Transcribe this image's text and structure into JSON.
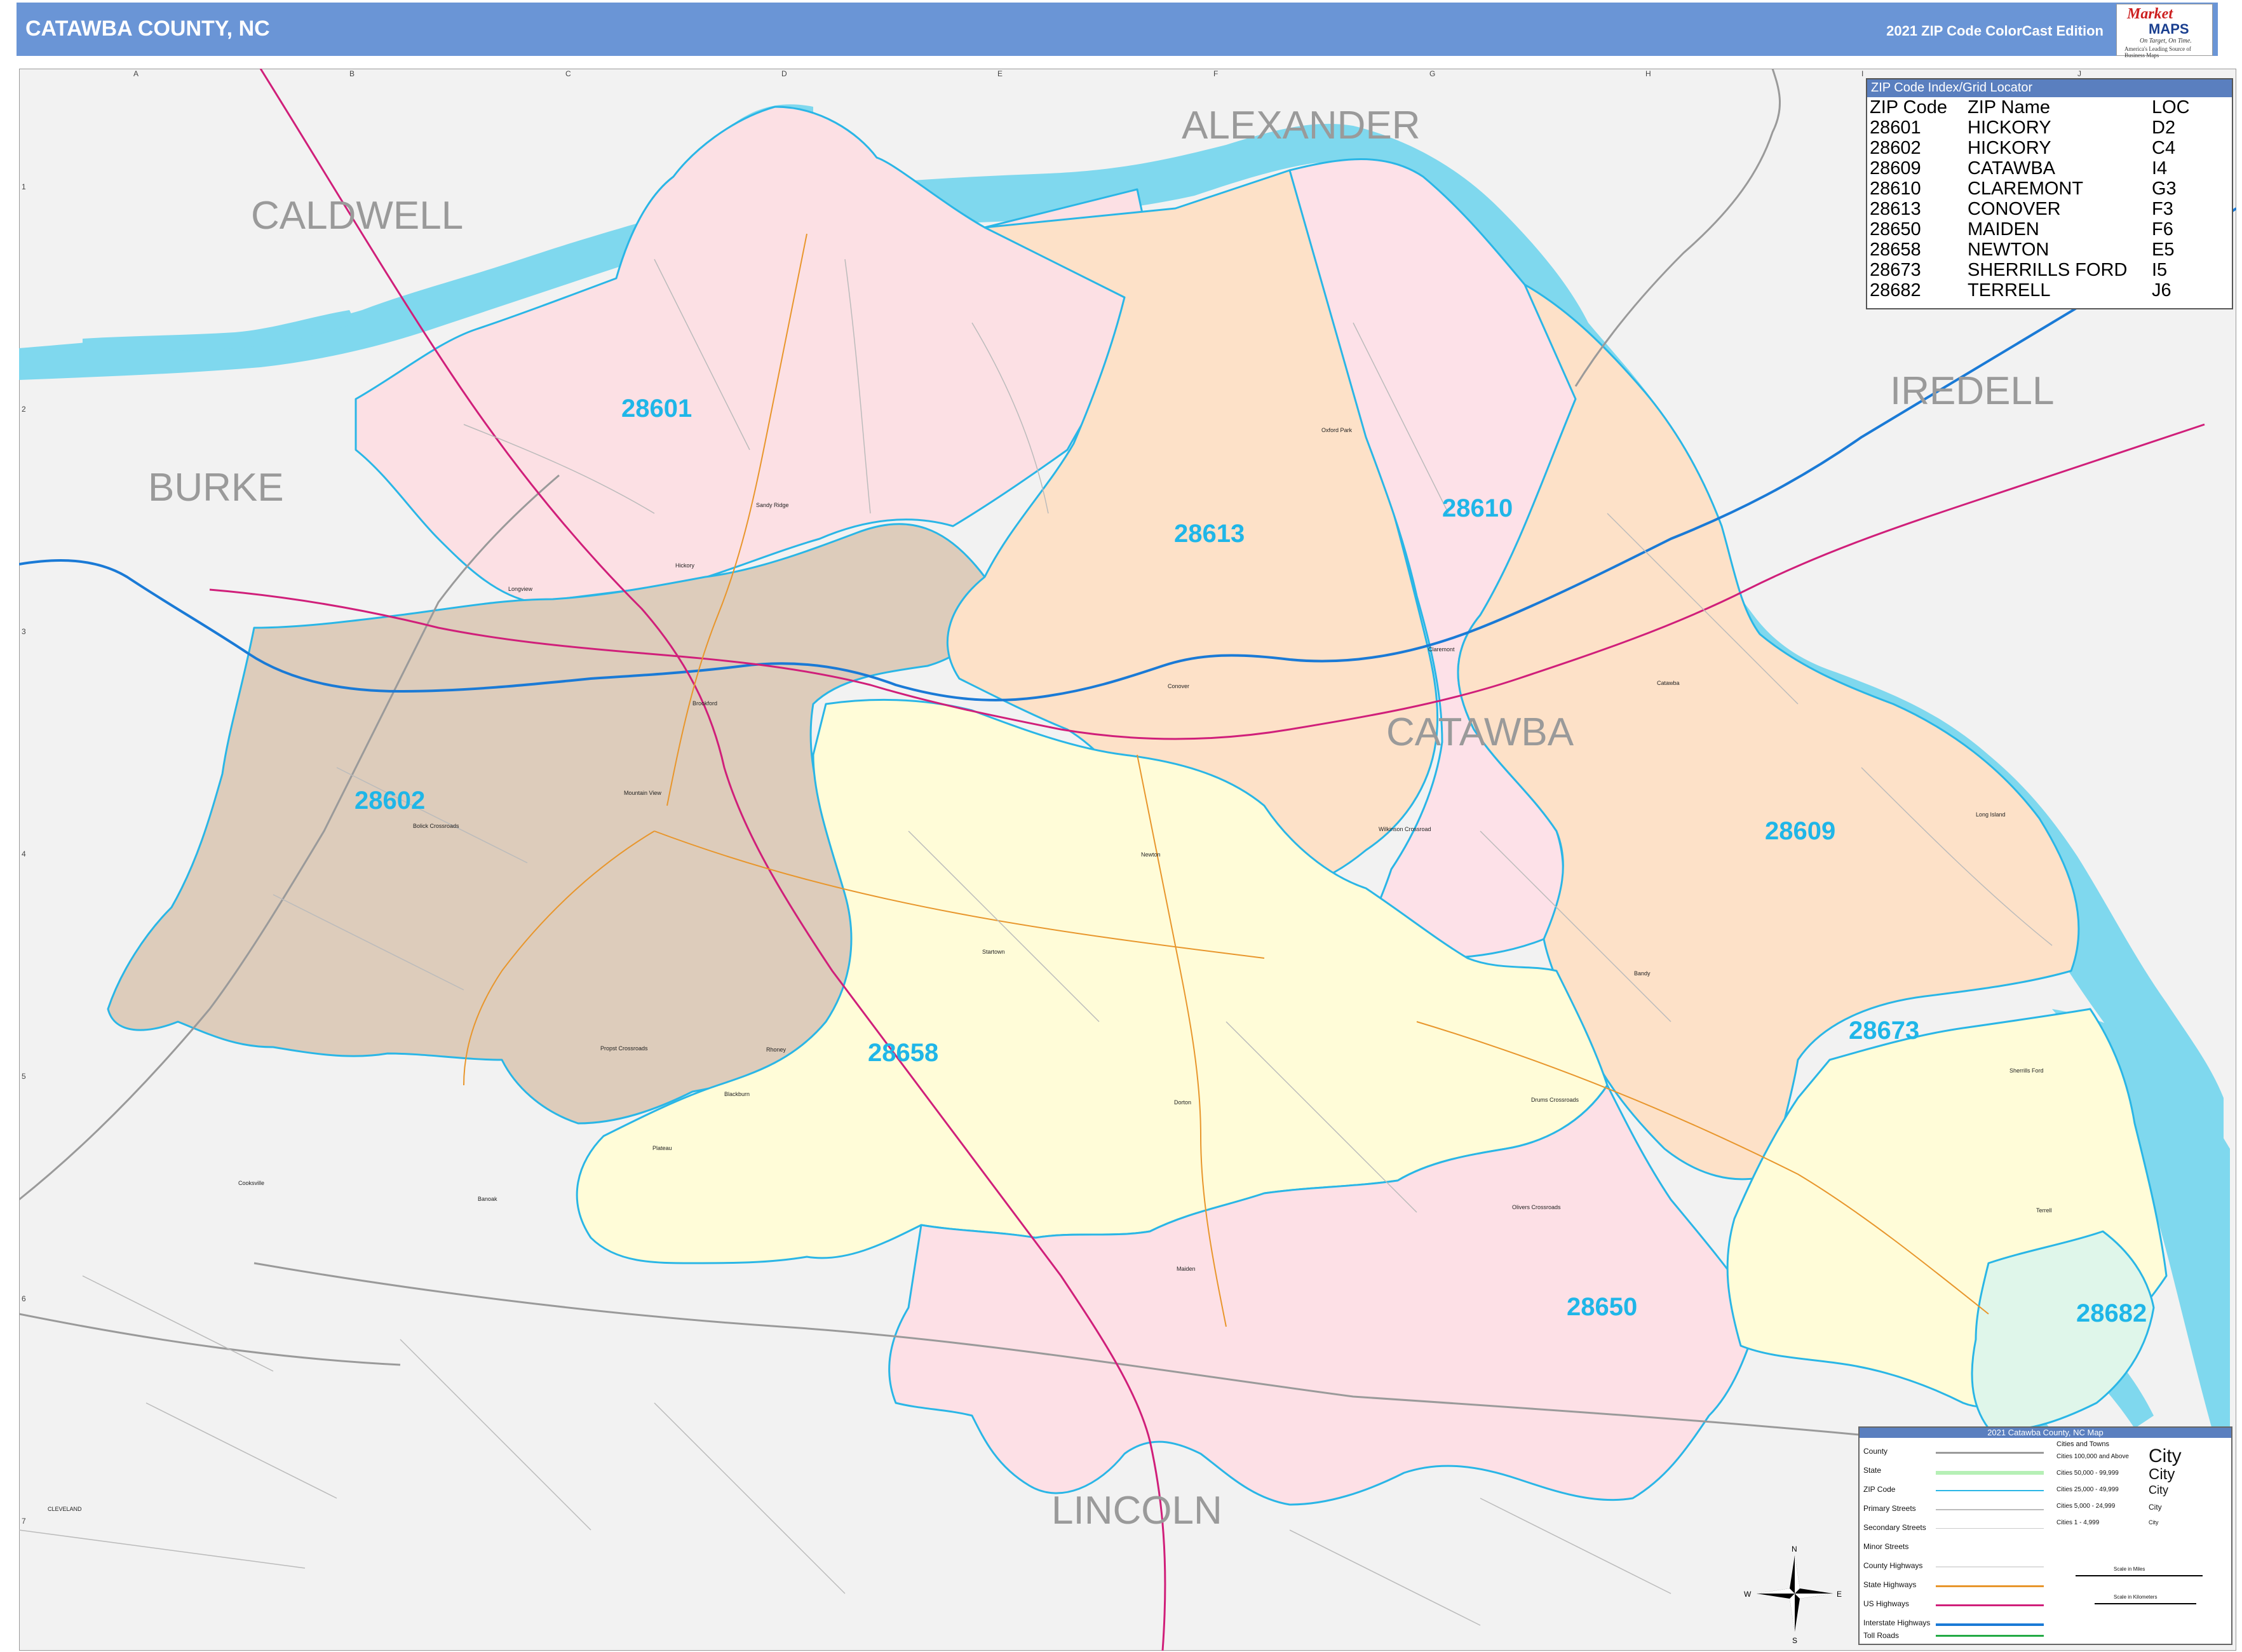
{
  "header": {
    "title": "CATAWBA COUNTY, NC",
    "edition": "2021 ZIP Code ColorCast Edition",
    "logo_brand_top": "Market",
    "logo_brand_bottom": "MAPS",
    "logo_tagline": "On Target, On Time.",
    "logo_subtagline": "America's Leading Source of Business Maps"
  },
  "grid": {
    "letters": [
      "A",
      "B",
      "C",
      "D",
      "E",
      "F",
      "G",
      "H",
      "I",
      "J"
    ],
    "numbers": [
      "1",
      "2",
      "3",
      "4",
      "5",
      "6",
      "7"
    ]
  },
  "counties": {
    "alexander": "ALEXANDER",
    "caldwell": "CALDWELL",
    "iredell": "IREDELL",
    "burke": "BURKE",
    "catawba": "CATAWBA",
    "lincoln": "LINCOLN",
    "cleveland": "CLEVELAND"
  },
  "zips": {
    "z28601": "28601",
    "z28602": "28602",
    "z28609": "28609",
    "z28610": "28610",
    "z28613": "28613",
    "z28650": "28650",
    "z28658": "28658",
    "z28673": "28673",
    "z28682": "28682"
  },
  "cities": {
    "hickory": "Hickory",
    "longview": "Longview",
    "brookford": "Brookford",
    "conover": "Conover",
    "newton": "Newton",
    "claremont": "Claremont",
    "catawba": "Catawba",
    "maiden": "Maiden",
    "mountain_view": "Mountain View",
    "oxford_park": "Oxford Park",
    "long_island": "Long Island",
    "sherrills_ford": "Sherrills Ford",
    "terrell": "Terrell",
    "bandy": "Bandy",
    "startown": "Startown",
    "blackburn": "Blackburn",
    "rhoney": "Rhoney",
    "propst_crossroads": "Propst Crossroads",
    "banoak": "Banoak",
    "cooksville": "Cooksville",
    "olivers_crossroads": "Olivers Crossroads",
    "drums_crossroads": "Drums Crossroads",
    "wilkinson_crossroad": "Wilkinson Crossroad",
    "plateau": "Plateau",
    "dorton": "Dorton",
    "bolick_crossroads": "Bolick Crossroads",
    "sandy_ridge": "Sandy Ridge"
  },
  "zip_index": {
    "title": "ZIP Code Index/Grid Locator",
    "headers": [
      "ZIP Code",
      "ZIP Name",
      "LOC"
    ],
    "rows": [
      [
        "28601",
        "HICKORY",
        "D2"
      ],
      [
        "28602",
        "HICKORY",
        "C4"
      ],
      [
        "28609",
        "CATAWBA",
        "I4"
      ],
      [
        "28610",
        "CLAREMONT",
        "G3"
      ],
      [
        "28613",
        "CONOVER",
        "F3"
      ],
      [
        "28650",
        "MAIDEN",
        "F6"
      ],
      [
        "28658",
        "NEWTON",
        "E5"
      ],
      [
        "28673",
        "SHERRILLS FORD",
        "I5"
      ],
      [
        "28682",
        "TERRELL",
        "J6"
      ]
    ]
  },
  "legend": {
    "title": "2021 Catawba County, NC Map",
    "items": [
      "County",
      "State",
      "ZIP Code",
      "Primary Streets",
      "Secondary Streets",
      "Minor Streets",
      "County Highways",
      "State Highways",
      "US Highways",
      "Interstate Highways",
      "Toll Roads"
    ],
    "cities_header": "Cities and Towns",
    "pop_ranges": [
      "Cities 100,000 and Above",
      "Cities 50,000 - 99,999",
      "Cities 25,000 - 49,999",
      "Cities 5,000 - 24,999",
      "Cities 1 - 4,999"
    ],
    "city_word": "City",
    "scale_miles": "Scale in Miles",
    "scale_km": "Scale in Kilometers",
    "compass": {
      "n": "N",
      "s": "S",
      "e": "E",
      "w": "W"
    }
  },
  "colors": {
    "header_bg": "#6a95d6",
    "water": "#7fd8ee",
    "zip_border": "#2ab6e6",
    "zip_label": "#1fb6e8",
    "zip_28601": "#fce0e4",
    "zip_28602": "#ddccbb",
    "zip_28609": "#fde1c8",
    "zip_28610": "#fde1e8",
    "zip_28613": "#fde1c8",
    "zip_28650": "#fde0e6",
    "zip_28658": "#fffcd8",
    "zip_28673": "#fffcd8",
    "zip_28682": "#dff6ea",
    "interstate": "#1a7ad6",
    "us_highway": "#d01f7a",
    "state_highway": "#e8962c",
    "outside": "#f2f2f2"
  }
}
